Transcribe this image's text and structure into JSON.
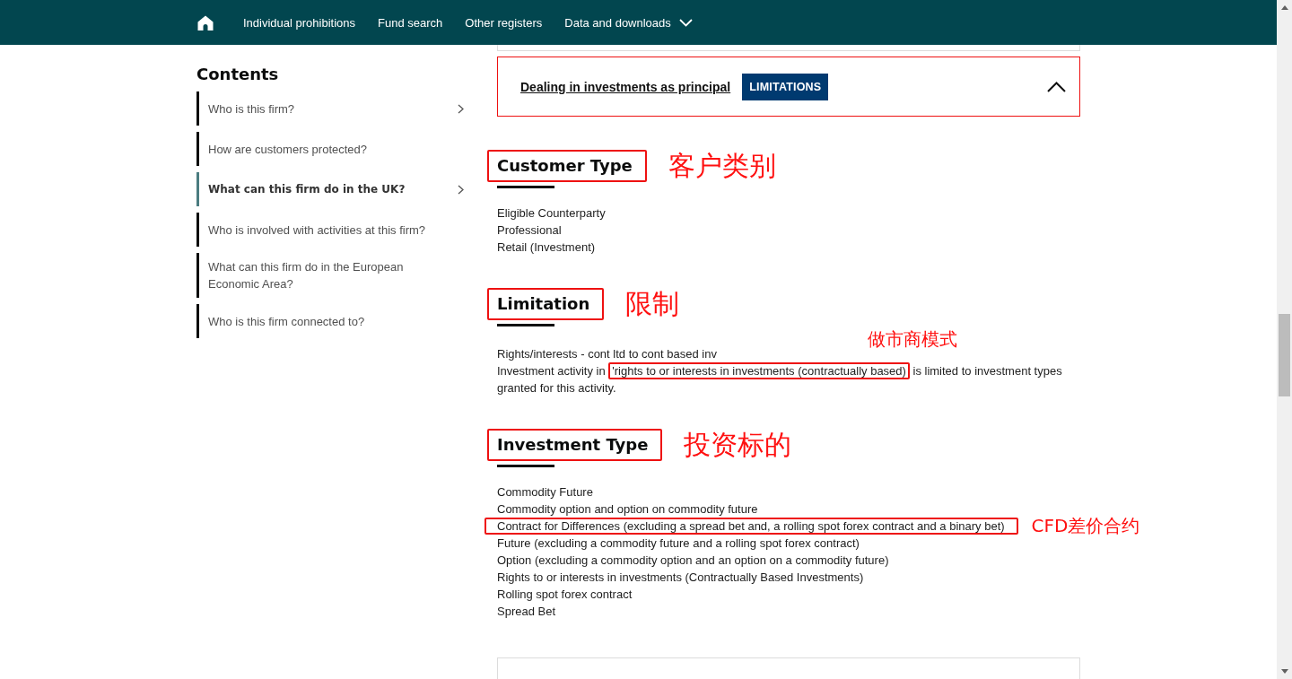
{
  "nav": {
    "items": [
      {
        "label": "Individual prohibitions",
        "kind": "link"
      },
      {
        "label": "Fund search",
        "kind": "link"
      },
      {
        "label": "Other registers",
        "kind": "link"
      },
      {
        "label": "Data and downloads",
        "kind": "dropdown"
      }
    ]
  },
  "sidebar": {
    "title": "Contents",
    "items": [
      {
        "label": "Who is this firm?",
        "selected": false,
        "expandable": true
      },
      {
        "label": "How are customers protected?",
        "selected": false,
        "expandable": false
      },
      {
        "label": "What can this firm do in the UK?",
        "selected": true,
        "expandable": true
      },
      {
        "label": "Who is involved with activities at this firm?",
        "selected": false,
        "expandable": false
      },
      {
        "label": "What can this firm do in the European Economic Area?",
        "selected": false,
        "expandable": false
      },
      {
        "label": "Who is this firm connected to?",
        "selected": false,
        "expandable": false
      }
    ]
  },
  "activity": {
    "title": "Dealing in investments as principal",
    "badge": "LIMITATIONS",
    "expanded": true
  },
  "sections": [
    {
      "kind": "list",
      "heading": "Customer Type",
      "annotated": true,
      "note": "客户类别",
      "items": [
        {
          "label": "Eligible Counterparty",
          "annotated": false
        },
        {
          "label": "Professional",
          "annotated": false
        },
        {
          "label": "Retail (Investment)",
          "annotated": false
        }
      ]
    },
    {
      "kind": "limitation",
      "heading": "Limitation",
      "annotated": true,
      "note": "限制",
      "title": "Rights/interests - cont ltd to cont based inv",
      "description": {
        "before": "Investment activity in ",
        "highlighted": "'rights to or interests in investments (contractually based)",
        "after": " is limited to investment types granted for this activity.",
        "note": "做市商模式"
      }
    },
    {
      "kind": "list",
      "heading": "Investment Type",
      "annotated": true,
      "note": "投资标的",
      "items": [
        {
          "label": "Commodity Future",
          "annotated": false
        },
        {
          "label": "Commodity option and option on commodity future",
          "annotated": false
        },
        {
          "label": "Contract for Differences (excluding a spread bet and, a rolling spot forex contract and a binary bet)",
          "annotated": true,
          "note": "CFD差价合约"
        },
        {
          "label": "Future (excluding a commodity future and a rolling spot forex contract)",
          "annotated": false
        },
        {
          "label": "Option (excluding a commodity option and an option on a commodity future)",
          "annotated": false
        },
        {
          "label": "Rights to or interests in investments (Contractually Based Investments)",
          "annotated": false
        },
        {
          "label": "Rolling spot forex contract",
          "annotated": false
        },
        {
          "label": "Spread Bet",
          "annotated": false
        }
      ]
    }
  ]
}
